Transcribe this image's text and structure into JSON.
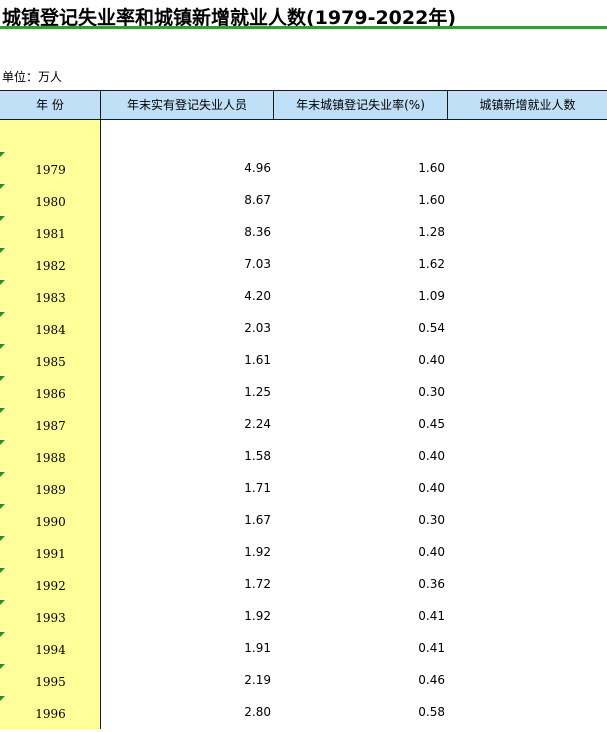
{
  "title": "城镇登记失业率和城镇新增就业人数(1979-2022年)",
  "unit_label": "单位：万人",
  "headers": {
    "year": "年  份",
    "registered_unemployed": "年末实有登记失业人员",
    "unemployment_rate": "年末城镇登记失业率(%)",
    "new_employment": "城镇新增就业人数"
  },
  "rows": [
    {
      "year": "1979",
      "registered_unemployed": "4.96",
      "unemployment_rate": "1.60",
      "new_employment": ""
    },
    {
      "year": "1980",
      "registered_unemployed": "8.67",
      "unemployment_rate": "1.60",
      "new_employment": ""
    },
    {
      "year": "1981",
      "registered_unemployed": "8.36",
      "unemployment_rate": "1.28",
      "new_employment": ""
    },
    {
      "year": "1982",
      "registered_unemployed": "7.03",
      "unemployment_rate": "1.62",
      "new_employment": ""
    },
    {
      "year": "1983",
      "registered_unemployed": "4.20",
      "unemployment_rate": "1.09",
      "new_employment": ""
    },
    {
      "year": "1984",
      "registered_unemployed": "2.03",
      "unemployment_rate": "0.54",
      "new_employment": ""
    },
    {
      "year": "1985",
      "registered_unemployed": "1.61",
      "unemployment_rate": "0.40",
      "new_employment": ""
    },
    {
      "year": "1986",
      "registered_unemployed": "1.25",
      "unemployment_rate": "0.30",
      "new_employment": ""
    },
    {
      "year": "1987",
      "registered_unemployed": "2.24",
      "unemployment_rate": "0.45",
      "new_employment": ""
    },
    {
      "year": "1988",
      "registered_unemployed": "1.58",
      "unemployment_rate": "0.40",
      "new_employment": ""
    },
    {
      "year": "1989",
      "registered_unemployed": "1.71",
      "unemployment_rate": "0.40",
      "new_employment": ""
    },
    {
      "year": "1990",
      "registered_unemployed": "1.67",
      "unemployment_rate": "0.30",
      "new_employment": ""
    },
    {
      "year": "1991",
      "registered_unemployed": "1.92",
      "unemployment_rate": "0.40",
      "new_employment": ""
    },
    {
      "year": "1992",
      "registered_unemployed": "1.72",
      "unemployment_rate": "0.36",
      "new_employment": ""
    },
    {
      "year": "1993",
      "registered_unemployed": "1.92",
      "unemployment_rate": "0.41",
      "new_employment": ""
    },
    {
      "year": "1994",
      "registered_unemployed": "1.91",
      "unemployment_rate": "0.41",
      "new_employment": ""
    },
    {
      "year": "1995",
      "registered_unemployed": "2.19",
      "unemployment_rate": "0.46",
      "new_employment": ""
    },
    {
      "year": "1996",
      "registered_unemployed": "2.80",
      "unemployment_rate": "0.58",
      "new_employment": ""
    }
  ],
  "colors": {
    "header_bg": "#bfe0f7",
    "year_column_bg": "#ffff99",
    "title_rule": "#3c9a3c",
    "cell_marker": "#2e8b2e"
  }
}
